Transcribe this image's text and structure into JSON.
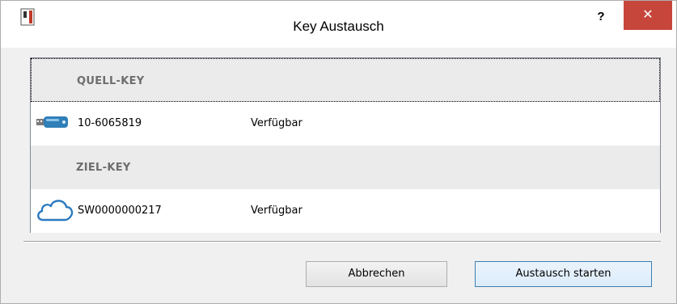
{
  "window": {
    "title": "Key Austausch",
    "help_label": "?",
    "close_label": "✕"
  },
  "list": {
    "source_header": "QUELL-KEY",
    "source_key": {
      "id": "10-6065819",
      "status": "Verfügbar",
      "icon": "usb-dongle-icon"
    },
    "target_header": "ZIEL-KEY",
    "target_key": {
      "id": "SW0000000217",
      "status": "Verfügbar",
      "icon": "cloud-icon"
    }
  },
  "buttons": {
    "cancel": "Abbrechen",
    "start": "Austausch starten"
  },
  "colors": {
    "close_button": "#c7463b",
    "usb_blue": "#2f7fb8",
    "cloud_blue": "#2a7abf",
    "header_bg": "#ebebeb"
  }
}
